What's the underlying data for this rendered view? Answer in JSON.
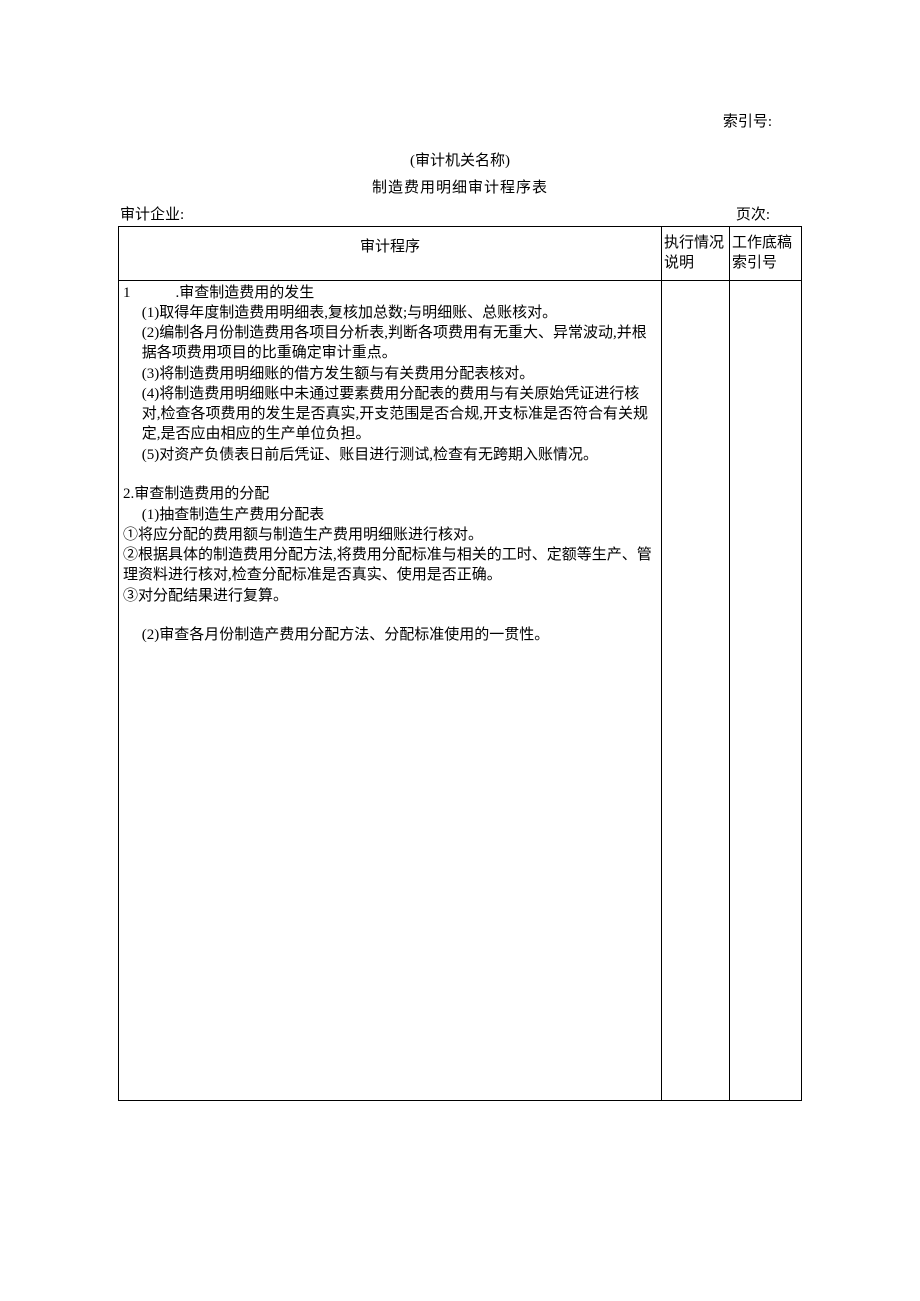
{
  "header": {
    "index_label": "索引号:",
    "org_name": "(审计机关名称)",
    "title": "制造费用明细审计程序表",
    "enterprise_label": "审计企业:",
    "page_label": "页次:"
  },
  "table": {
    "columns": {
      "procedure": "审计程序",
      "execution": "执行情况说明",
      "ref": "工作底稿索引号"
    },
    "section1": {
      "heading_num": "1",
      "heading_text": ".审查制造费用的发生",
      "item1": "(1)取得年度制造费用明细表,复核加总数;与明细账、总账核对。",
      "item2": "(2)编制各月份制造费用各项目分析表,判断各项费用有无重大、异常波动,并根据各项费用项目的比重确定审计重点。",
      "item3": "(3)将制造费用明细账的借方发生额与有关费用分配表核对。",
      "item4": "(4)将制造费用明细账中未通过要素费用分配表的费用与有关原始凭证进行核对,检查各项费用的发生是否真实,开支范围是否合规,开支标准是否符合有关规定,是否应由相应的生产单位负担。",
      "item5": "(5)对资产负债表日前后凭证、账目进行测试,检查有无跨期入账情况。"
    },
    "section2": {
      "heading": "2.审查制造费用的分配",
      "item1": "(1)抽查制造生产费用分配表",
      "sub1": "①将应分配的费用额与制造生产费用明细账进行核对。",
      "sub2": "②根据具体的制造费用分配方法,将费用分配标准与相关的工时、定额等生产、管理资料进行核对,检查分配标准是否真实、使用是否正确。",
      "sub3": "③对分配结果进行复算。",
      "item2": "(2)审查各月份制造产费用分配方法、分配标准使用的一贯性。"
    }
  }
}
